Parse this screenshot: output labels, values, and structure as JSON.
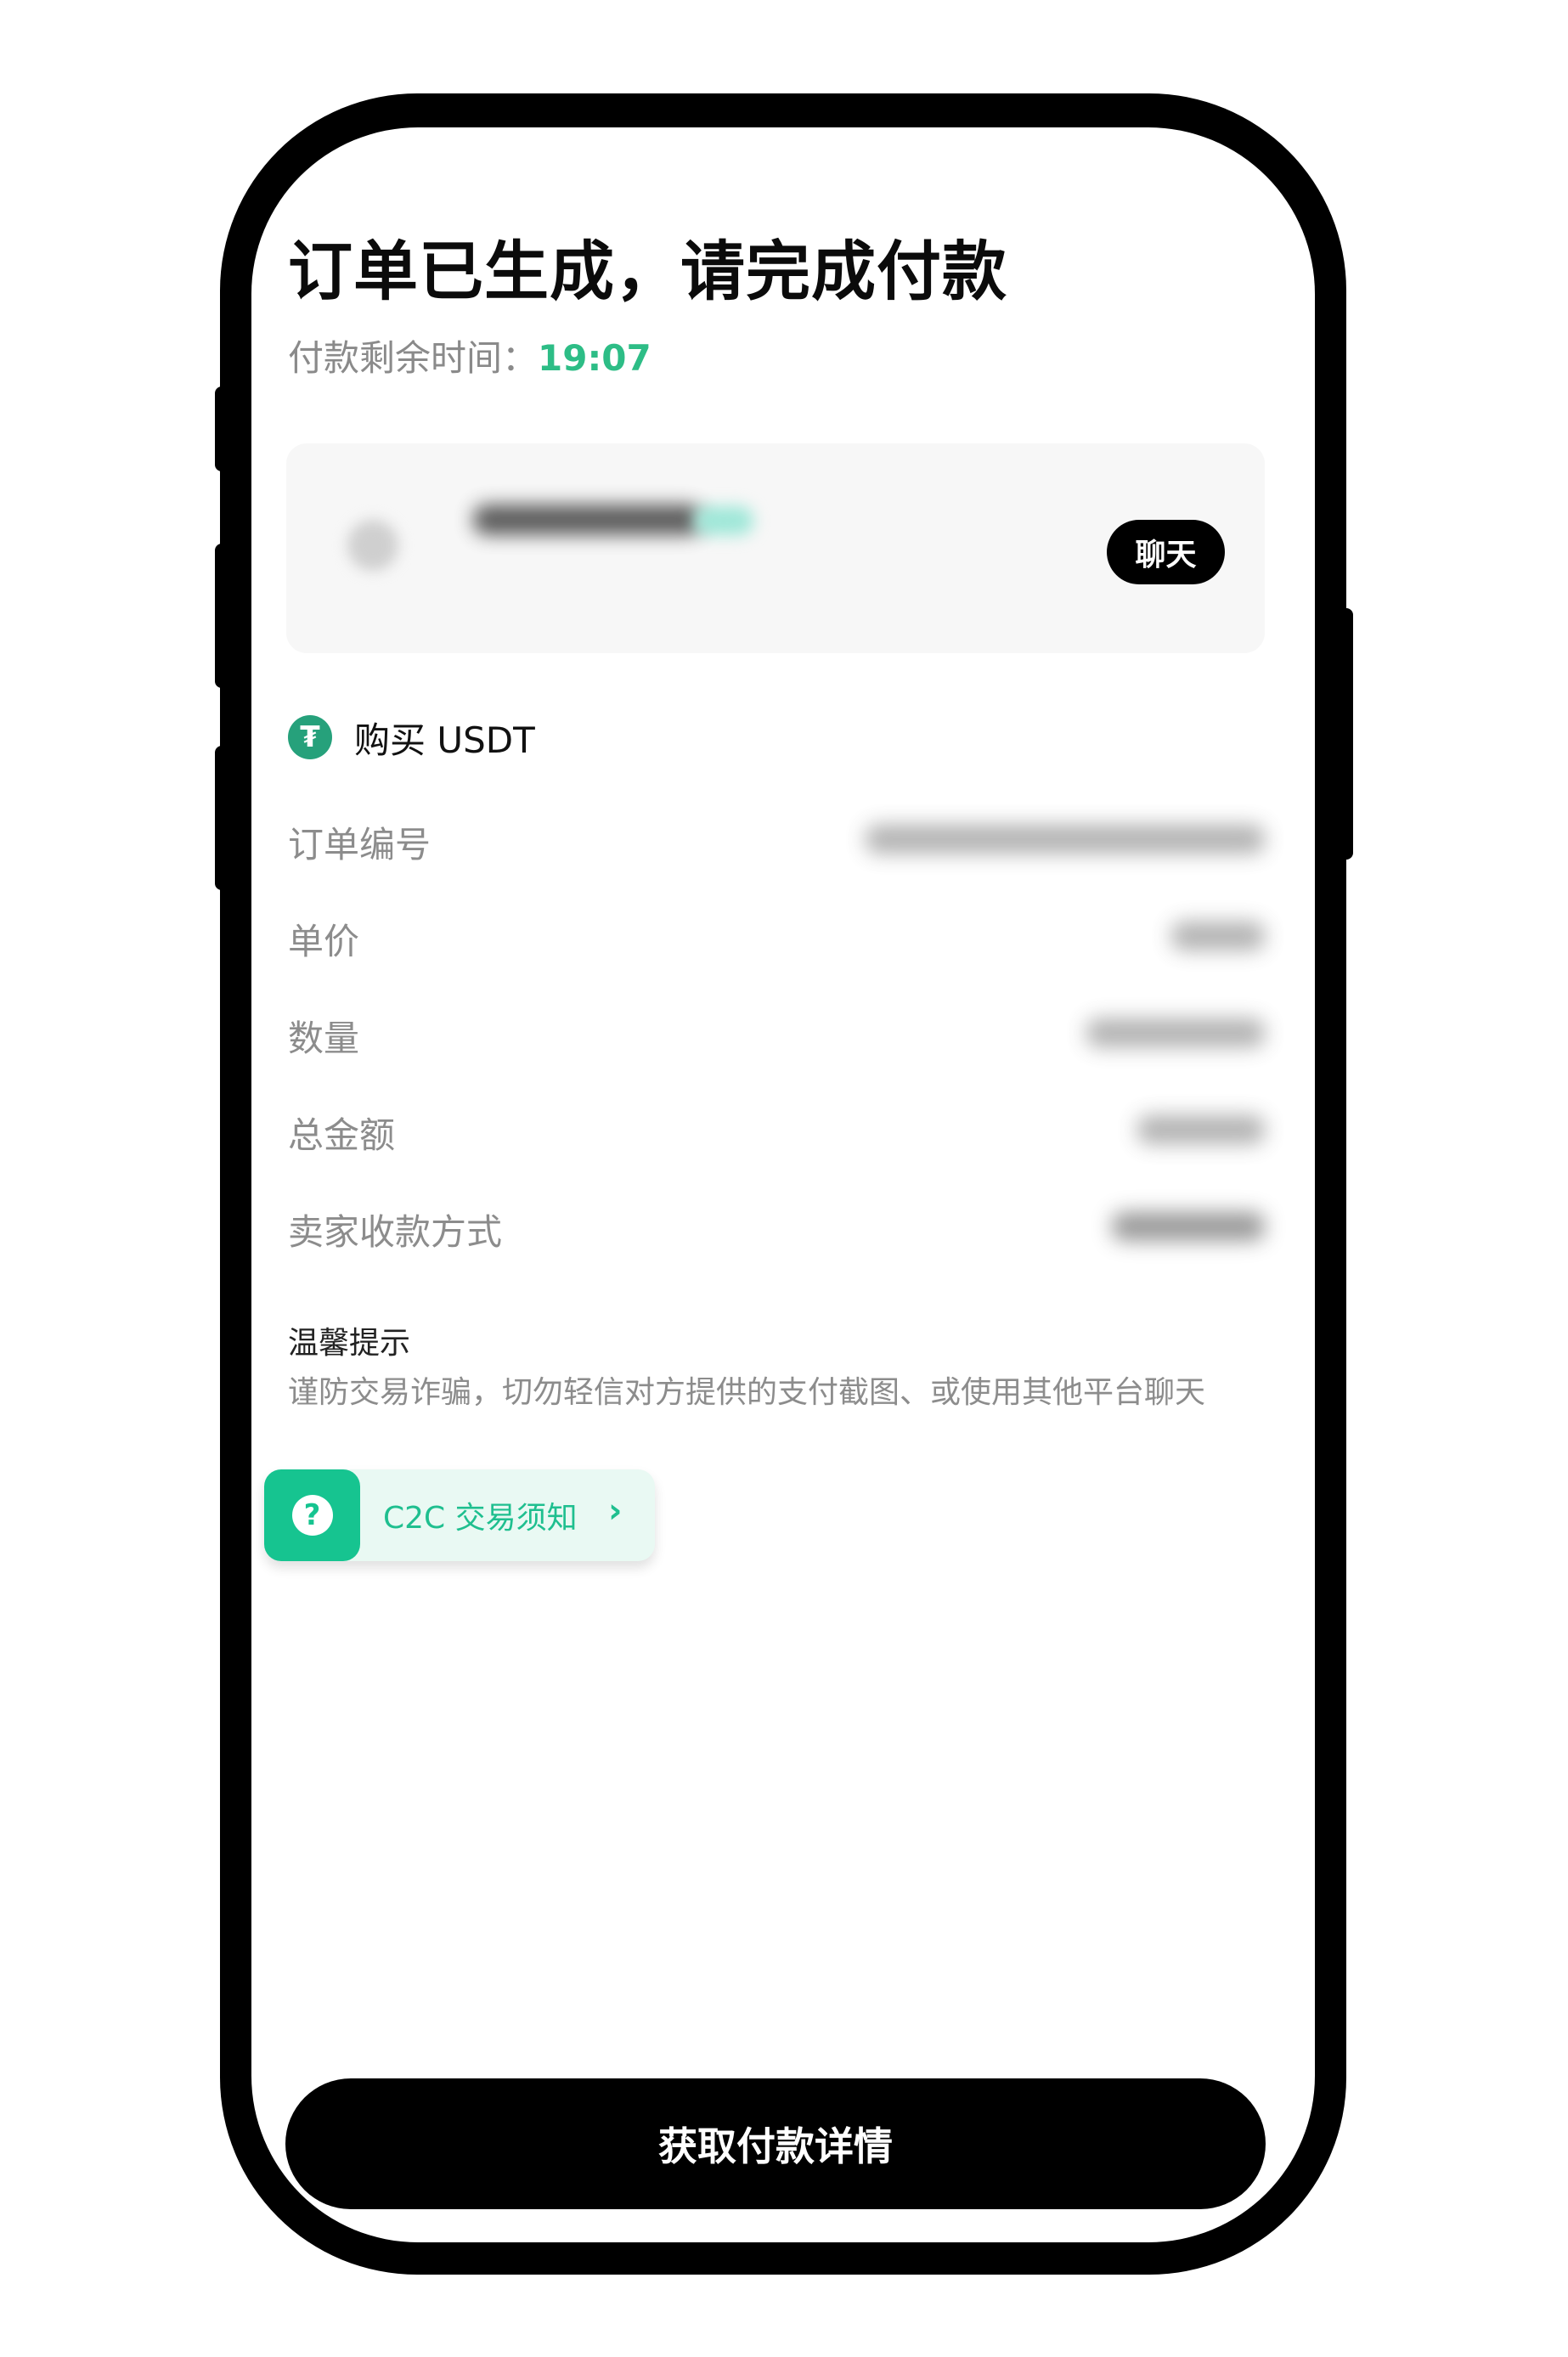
{
  "header": {
    "title": "订单已生成，请完成付款",
    "timer_label": "付款剩余时间：",
    "timer_value": "19:07"
  },
  "seller": {
    "chat_label": "聊天"
  },
  "order": {
    "buy_label": "购买 USDT",
    "rows": [
      {
        "label": "订单编号"
      },
      {
        "label": "单价"
      },
      {
        "label": "数量"
      },
      {
        "label": "总金额"
      },
      {
        "label": "卖家收款方式"
      }
    ]
  },
  "tips": {
    "title": "温馨提示",
    "text": "谨防交易诈骗，切勿轻信对方提供的支付截图、或使用其他平台聊天"
  },
  "c2c": {
    "label": "C2C 交易须知",
    "icon": "help-icon"
  },
  "cta": {
    "label": "获取付款详情"
  },
  "colors": {
    "accent_green": "#2dbd86",
    "usdt_green": "#26a17b",
    "frame": "#000000"
  }
}
